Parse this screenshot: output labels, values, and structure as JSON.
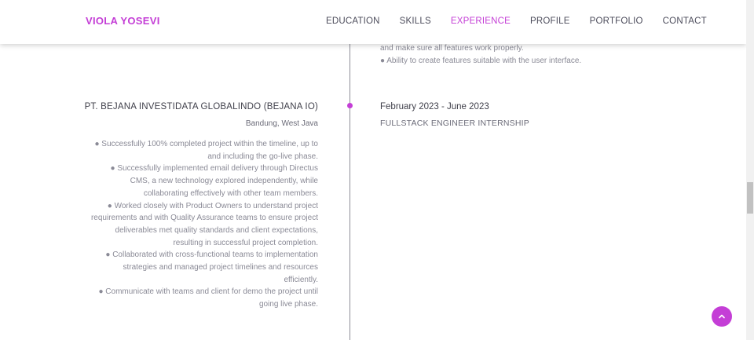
{
  "header": {
    "brand": "VIOLA YOSEVI",
    "nav": [
      {
        "label": "EDUCATION"
      },
      {
        "label": "SKILLS"
      },
      {
        "label": "EXPERIENCE",
        "active": true
      },
      {
        "label": "PROFILE"
      },
      {
        "label": "PORTFOLIO"
      },
      {
        "label": "CONTACT"
      }
    ]
  },
  "previous_entry": {
    "lines": [
      "and make sure all features work properly.",
      "● Ability to create features suitable with the user interface."
    ]
  },
  "experience": {
    "company": "PT. BEJANA INVESTIDATA GLOBALINDO (BEJANA IO)",
    "location": "Bandung, West Java",
    "date": "February 2023 - June 2023",
    "role": "FULLSTACK ENGINEER INTERNSHIP",
    "bullets": [
      "● Successfully 100% completed project within the timeline, up to and including the go-live phase.",
      "● Successfully implemented email delivery through Directus CMS, a new technology explored independently, while collaborating effectively with other team members.",
      "● Worked closely with Product Owners to understand project requirements and with Quality Assurance teams to ensure project deliverables met quality standards and client expectations, resulting in successful project completion.",
      "● Collaborated with cross-functional teams to implementation strategies and managed project timelines and resources efficiently.",
      "● Communicate with teams and client for demo the project until going live phase."
    ]
  },
  "theme": {
    "accent": "#c43ed6"
  },
  "icons": {
    "back_to_top": "chevron-up-icon"
  }
}
